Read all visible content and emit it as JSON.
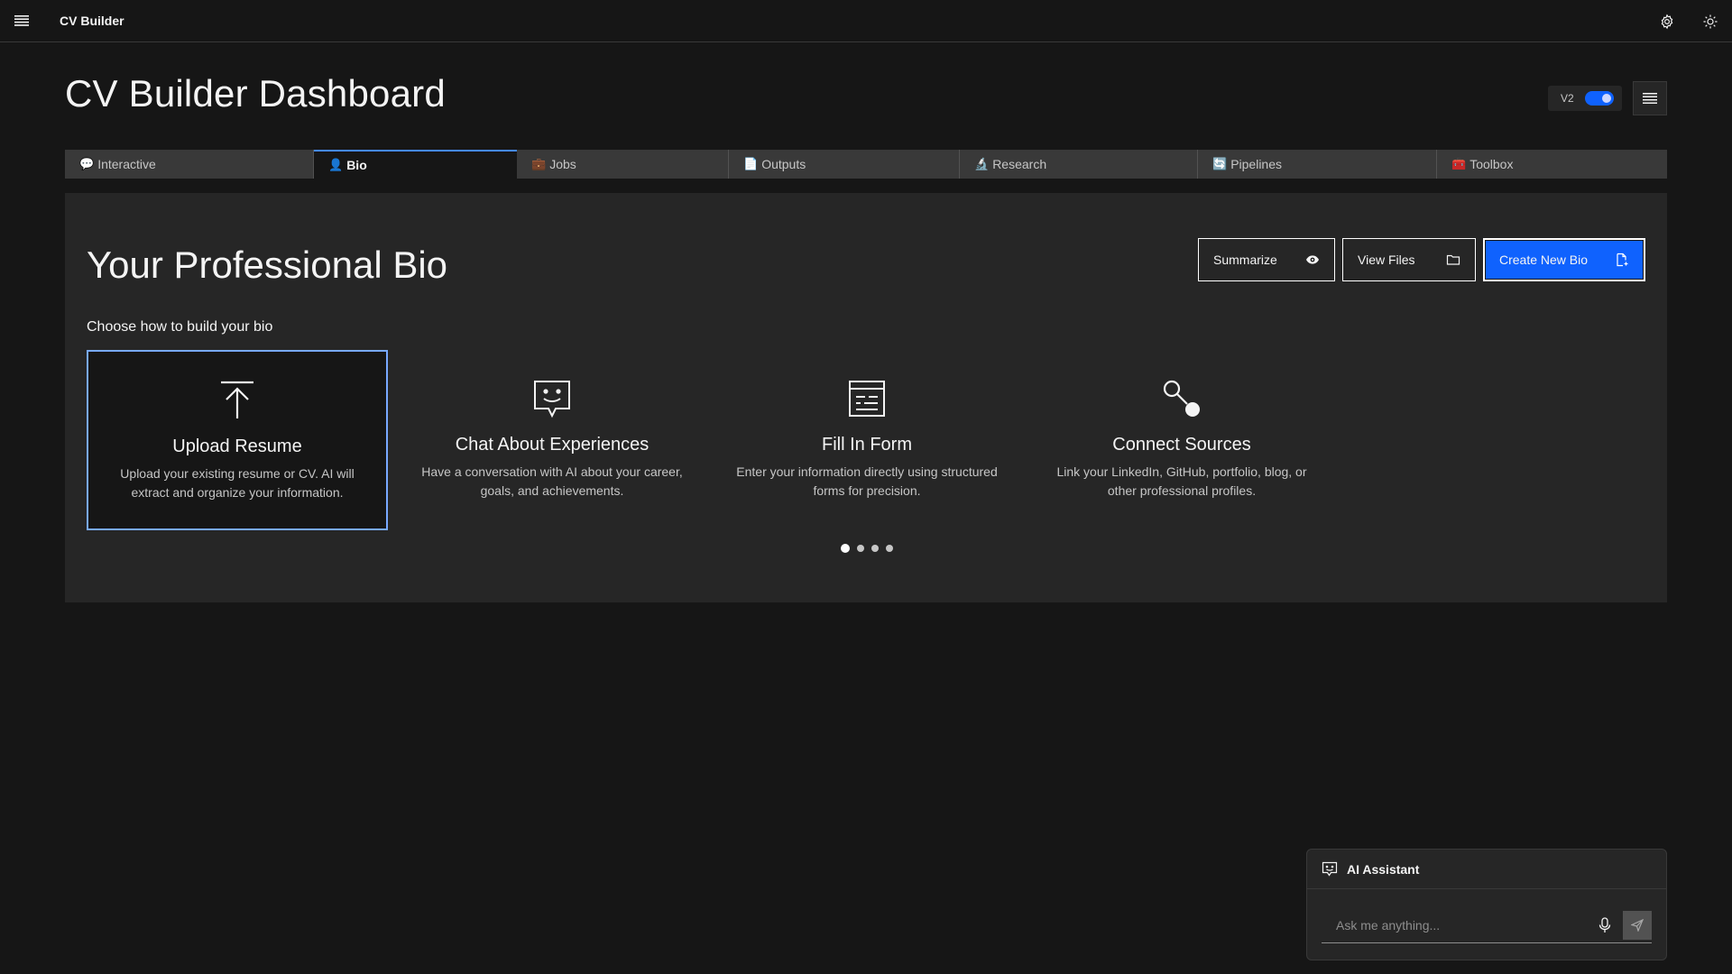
{
  "header": {
    "app_name": "CV Builder",
    "menu_icon": "menu-icon",
    "settings_icon": "gear-icon",
    "theme_icon": "sun-icon"
  },
  "page": {
    "title": "CV Builder Dashboard",
    "version_label": "V2",
    "version_toggle_on": true
  },
  "tabs": [
    {
      "icon": "💬",
      "label": "Interactive",
      "active": false
    },
    {
      "icon": "👤",
      "label": "Bio",
      "active": true
    },
    {
      "icon": "💼",
      "label": "Jobs",
      "active": false
    },
    {
      "icon": "📄",
      "label": "Outputs",
      "active": false
    },
    {
      "icon": "🔬",
      "label": "Research",
      "active": false
    },
    {
      "icon": "🔄",
      "label": "Pipelines",
      "active": false
    },
    {
      "icon": "🧰",
      "label": "Toolbox",
      "active": false
    }
  ],
  "bio": {
    "title": "Your Professional Bio",
    "subtitle": "Choose how to build your bio",
    "actions": {
      "summarize": "Summarize",
      "view_files": "View Files",
      "create_new": "Create New Bio"
    },
    "options": [
      {
        "icon": "upload-icon",
        "title": "Upload Resume",
        "description": "Upload your existing resume or CV. AI will extract and organize your information.",
        "selected": true
      },
      {
        "icon": "chat-bot-icon",
        "title": "Chat About Experiences",
        "description": "Have a conversation with AI about your career, goals, and achievements.",
        "selected": false
      },
      {
        "icon": "form-icon",
        "title": "Fill In Form",
        "description": "Enter your information directly using structured forms for precision.",
        "selected": false
      },
      {
        "icon": "connect-icon",
        "title": "Connect Sources",
        "description": "Link your LinkedIn, GitHub, portfolio, blog, or other professional profiles.",
        "selected": false
      }
    ],
    "pager": {
      "pages": 4,
      "current": 1
    }
  },
  "assistant": {
    "title": "AI Assistant",
    "placeholder": "Ask me anything..."
  },
  "colors": {
    "background": "#161616",
    "panel": "#262626",
    "accent": "#0f62fe",
    "selected_border": "#78a9ff"
  }
}
